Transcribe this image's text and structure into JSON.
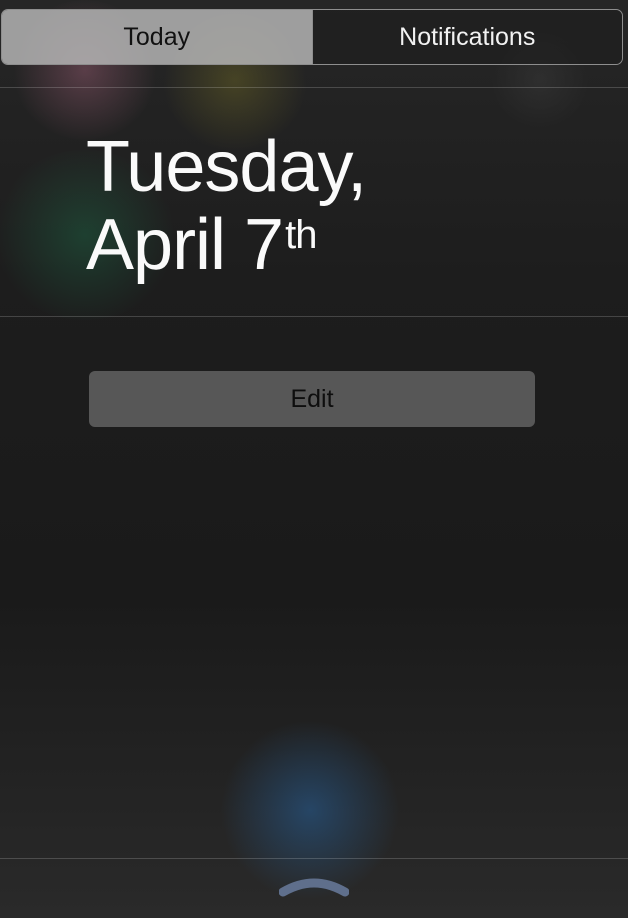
{
  "segmented_control": {
    "today_label": "Today",
    "notifications_label": "Notifications",
    "selected": "Today"
  },
  "date": {
    "weekday": "Tuesday,",
    "month_day": "April 7",
    "suffix": "th"
  },
  "edit_button": {
    "label": "Edit"
  },
  "pull_handle": {
    "icon": "chevron-up-icon"
  },
  "colors": {
    "background": "#1c1c1c",
    "selected_segment": "#b4b4b4",
    "edit_button": "#575757",
    "handle": "#5f6f8c"
  }
}
